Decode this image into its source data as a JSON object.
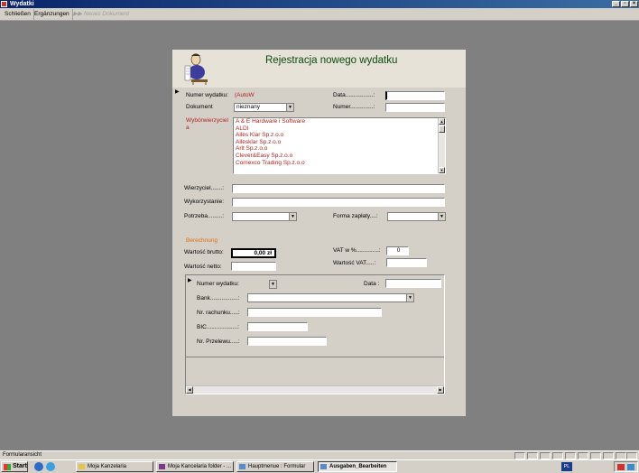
{
  "window": {
    "title": "Wydatki"
  },
  "toolbar": {
    "close_label": "Schließen",
    "extras_label": "Ergänzungen",
    "new_doc_label": "Neues Dokument"
  },
  "form": {
    "title": "Rejestracja nowego wydatku",
    "numer_wydatku_label": "Numer wydatku:",
    "numer_wydatku_value": "(AutoW",
    "data_label": "Data.................:",
    "data_value": "",
    "dokument_label": "Dokument",
    "dokument_value": "nieznany",
    "numer_label": "Numer..............:",
    "numer_value": "",
    "wybor_label": "Wybórwierzyciela",
    "creditors": [
      "A & E Hardware i Software",
      "ALDI",
      "Alles Klar Sp.z.o.o",
      "Allesklar Sp.z.o.o",
      "Arlt Sp.z.o.o",
      "Clever&Easy Sp.z.o.o",
      "Comexco Trading Sp.z.o.o"
    ],
    "wierzyciel_label": "Wierzyciel.......:",
    "wierzyciel_value": "",
    "wykorzystanie_label": "Wykorzystanie:",
    "wykorzystanie_value": "",
    "potrzeba_label": "Potrzeba.........:",
    "potrzeba_value": "",
    "forma_label": "Forma zapłaty....:",
    "forma_value": "",
    "berechnung_label": "Berechnung",
    "brutto_label": "Wartość brutto:",
    "brutto_value": "0,00 zł",
    "vat_label": "VAT w %..............:",
    "vat_value": "0",
    "netto_label": "Wartość netto:",
    "netto_value": "",
    "vat_value_label": "Wartość VAT.....:",
    "vat_amount_value": ""
  },
  "subform": {
    "record_selector": "▶",
    "numer_wydatku_label": "Numer wydatku:",
    "data_label": "Data :",
    "bank_label": "Bank.................:",
    "rachunek_label": "Nr. rachunku.....:",
    "bic_label": "BIC...................:",
    "przelew_label": "Nr. Przelewu.....:"
  },
  "statusbar": {
    "text": "Formularansicht"
  },
  "taskbar": {
    "start_label": "Start",
    "tasks": [
      "Moja Kanzelaria",
      "Moja Kancelaria folder - ...",
      "Hauptmenue : Formular",
      "Ausgaben_Bearbeiten"
    ],
    "lang": "PL"
  }
}
